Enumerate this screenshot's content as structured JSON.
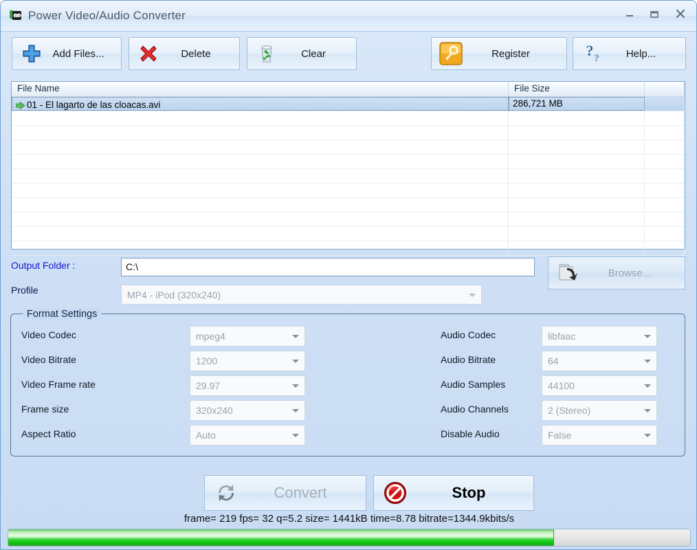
{
  "window": {
    "title": "Power Video/Audio Converter",
    "app_icon": "film-icon",
    "minimize_label": "–",
    "maximize_label": "☐",
    "close_label": "✕"
  },
  "toolbar": {
    "buttons": [
      {
        "label": "Add Files...",
        "icon": "plus-icon"
      },
      {
        "label": "Delete",
        "icon": "red-x-icon"
      },
      {
        "label": "Clear",
        "icon": "recycle-bin-icon"
      },
      {
        "label": "Register",
        "icon": "key-icon"
      },
      {
        "label": "Help...",
        "icon": "question-mark-icon"
      }
    ]
  },
  "file_list": {
    "columns": [
      "File Name",
      "File Size",
      ""
    ],
    "rows": [
      {
        "name": "01 - El lagarto de las cloacas.avi",
        "size": "286,721 MB",
        "selected": true,
        "icon": "green-arrow-icon"
      }
    ],
    "empty_row_count": 10
  },
  "output": {
    "folder_label": "Output Folder :",
    "folder_value": "C:\\",
    "folder_placeholder": "",
    "browse_label": "Browse...",
    "browse_icon": "folder-open-icon",
    "browse_enabled": false,
    "profile_label": "Profile",
    "profile_value": "MP4 - iPod (320x240)"
  },
  "format_settings": {
    "legend": "Format Settings",
    "left": [
      {
        "label": "Video Codec",
        "value": "mpeg4"
      },
      {
        "label": "Video Bitrate",
        "value": "1200"
      },
      {
        "label": "Video Frame rate",
        "value": "29.97"
      },
      {
        "label": "Frame size",
        "value": "320x240"
      },
      {
        "label": "Aspect Ratio",
        "value": "Auto"
      }
    ],
    "right": [
      {
        "label": "Audio Codec",
        "value": "libfaac"
      },
      {
        "label": "Audio Bitrate",
        "value": "64"
      },
      {
        "label": "Audio Samples",
        "value": "44100"
      },
      {
        "label": "Audio Channels",
        "value": "2 (Stereo)"
      },
      {
        "label": "Disable Audio",
        "value": "False"
      }
    ]
  },
  "actions": {
    "convert_label": "Convert",
    "convert_icon": "refresh-icon",
    "convert_enabled": false,
    "stop_label": "Stop",
    "stop_icon": "stop-sign-icon",
    "stop_enabled": true
  },
  "status": {
    "text": "frame=  219 fps= 32 q=5.2 size=    1441kB time=8.78 bitrate=1344.9kbits/s",
    "frame": 219,
    "fps": 32,
    "q": 5.2,
    "size": "1441kB",
    "time": "8.78",
    "bitrate": "1344.9kbits/s"
  },
  "progress": {
    "percent": 80,
    "fill_color": "#13c413",
    "track_color": "#e4e4e4"
  }
}
